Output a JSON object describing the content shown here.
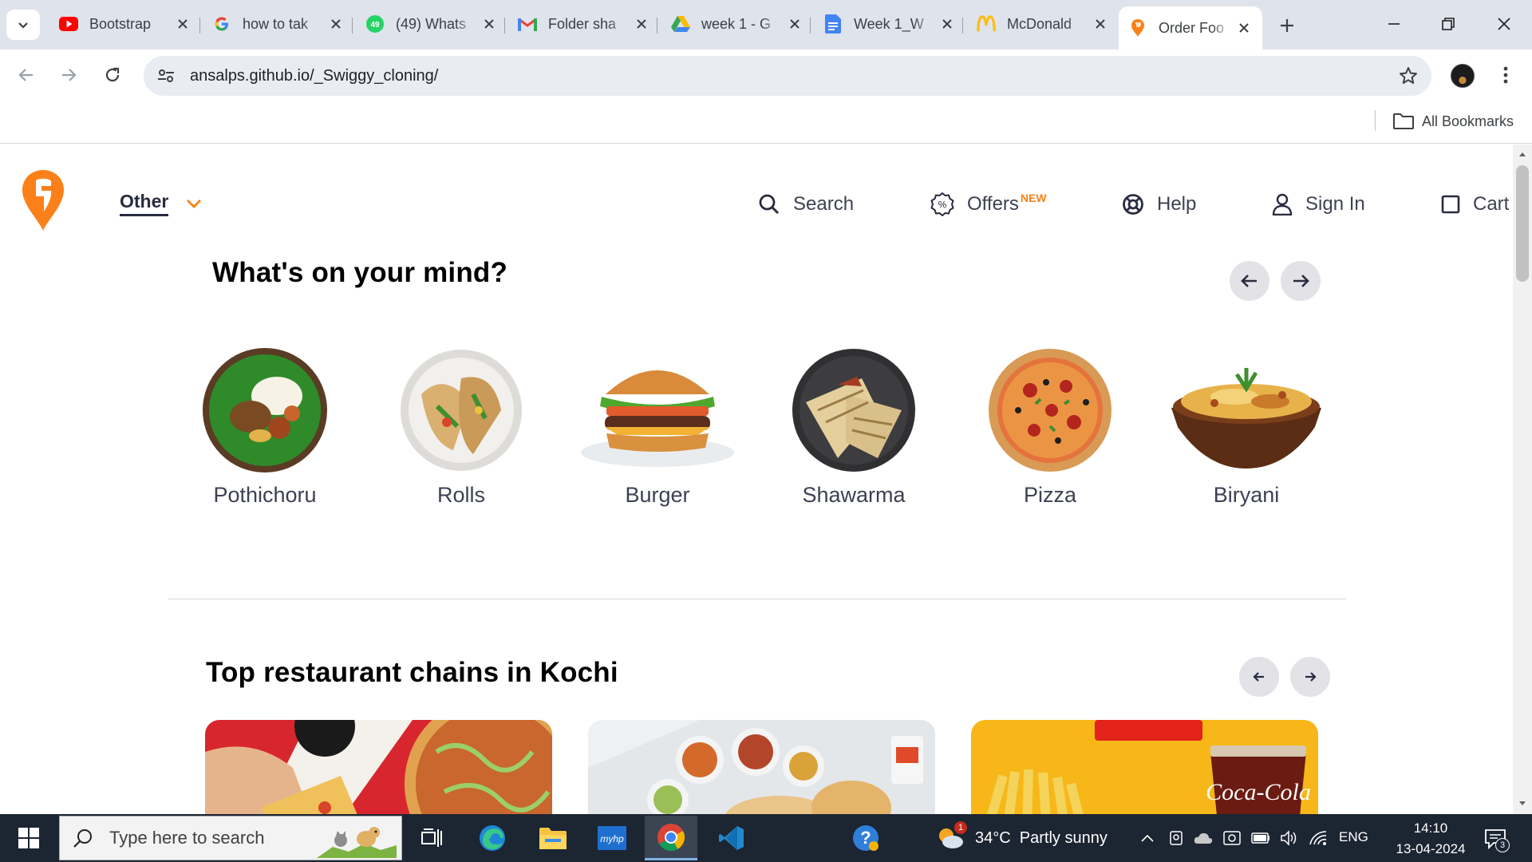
{
  "browser": {
    "tabs": [
      {
        "title": "Bootstrap",
        "icon": "youtube-icon"
      },
      {
        "title": "how to tak",
        "icon": "google-icon"
      },
      {
        "title": "(49) Whats",
        "icon": "whatsapp-icon"
      },
      {
        "title": "Folder sha",
        "icon": "gmail-icon"
      },
      {
        "title": "week 1 - G",
        "icon": "google-drive-icon"
      },
      {
        "title": "Week 1_W",
        "icon": "google-docs-icon"
      },
      {
        "title": "McDonald",
        "icon": "mcdonalds-icon"
      },
      {
        "title": "Order Foo",
        "icon": "swiggy-icon",
        "active": true
      }
    ],
    "url": "ansalps.github.io/_Swiggy_cloning/",
    "bookmarks_label": "All Bookmarks"
  },
  "site": {
    "location_label": "Other",
    "nav": {
      "search": "Search",
      "offers": "Offers",
      "offers_badge": "NEW",
      "help": "Help",
      "signin": "Sign In",
      "cart": "Cart"
    },
    "accent_color": "#fc8019"
  },
  "mind": {
    "title": "What's on your mind?",
    "items": [
      {
        "label": "Pothichoru"
      },
      {
        "label": "Rolls"
      },
      {
        "label": "Burger"
      },
      {
        "label": "Shawarma"
      },
      {
        "label": "Pizza"
      },
      {
        "label": "Biryani"
      }
    ]
  },
  "chains": {
    "title": "Top restaurant chains in Kochi",
    "cards": [
      {
        "name": "pizza-restaurant"
      },
      {
        "name": "indian-thali-restaurant"
      },
      {
        "name": "mcdonalds-restaurant"
      }
    ]
  },
  "taskbar": {
    "search_placeholder": "Type here to search",
    "weather": "34°C  Partly sunny",
    "weather_badge": "1",
    "language": "ENG",
    "time": "14:10",
    "date": "13-04-2024",
    "notifications": "3"
  }
}
